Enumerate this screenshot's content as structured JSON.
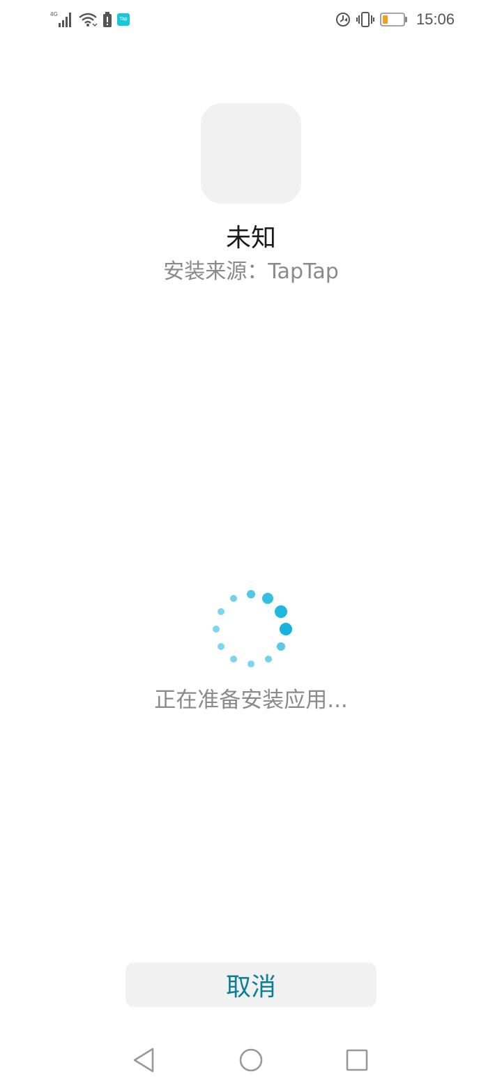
{
  "status_bar": {
    "network_type": "4G",
    "tap_badge": "Tap",
    "time": "15:06",
    "icons": [
      "signal-icon",
      "wifi-icon",
      "battery-alert-icon",
      "taptap-icon",
      "data-saver-icon",
      "vibrate-icon",
      "battery-icon"
    ],
    "battery_color": "#f0a020"
  },
  "app": {
    "name": "未知",
    "install_source": "安装来源：TapTap"
  },
  "loading": {
    "text": "正在准备安装应用...",
    "spinner_color": "#14b4dc"
  },
  "actions": {
    "cancel_label": "取消",
    "accent_color": "#0b7f94"
  },
  "nav_bar": {
    "icons": [
      "back-icon",
      "home-icon",
      "recents-icon"
    ]
  }
}
